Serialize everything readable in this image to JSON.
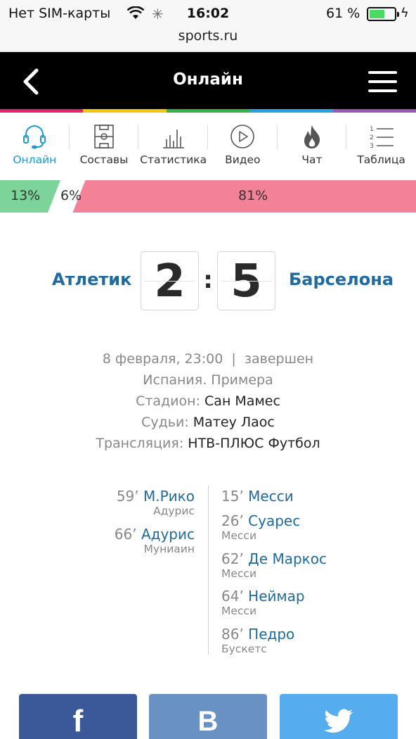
{
  "status_bar": {
    "carrier": "Нет SIM-карты",
    "time": "16:02",
    "battery_percent": "61 %",
    "battery_level": 0.61
  },
  "browser": {
    "url": "sports.ru"
  },
  "header": {
    "title": "Онлайн"
  },
  "color_strip": [
    "#e8246c",
    "#f6c512",
    "#34b34a",
    "#29a3e0",
    "#9b59b6"
  ],
  "tabs": [
    {
      "label": "Онлайн",
      "icon": "headset-icon",
      "active": true
    },
    {
      "label": "Составы",
      "icon": "field-icon",
      "active": false
    },
    {
      "label": "Статистика",
      "icon": "bar-chart-icon",
      "active": false
    },
    {
      "label": "Видео",
      "icon": "play-icon",
      "active": false
    },
    {
      "label": "Чат",
      "icon": "flame-icon",
      "active": false
    },
    {
      "label": "Таблица",
      "icon": "numbered-list-icon",
      "active": false
    }
  ],
  "prediction": {
    "home": "13%",
    "draw": "6%",
    "away": "81%",
    "home_value": 13,
    "draw_value": 6,
    "away_value": 81,
    "colors": {
      "home": "#7dd49b",
      "away": "#f38197"
    }
  },
  "match": {
    "home_team": "Атлетик",
    "away_team": "Барселона",
    "home_score": "2",
    "away_score": "5",
    "separator": ":",
    "datetime": "8 февраля, 23:00",
    "status": "завершен",
    "tournament": "Испания. Примера",
    "stadium_label": "Стадион:",
    "stadium": "Сан Мамес",
    "referee_label": "Судьи:",
    "referee": "Матеу Лаос",
    "broadcast_label": "Трансляция:",
    "broadcast": "НТВ-ПЛЮС Футбол"
  },
  "goals": {
    "home": [
      {
        "minute": "59’",
        "scorer": "М.Рико",
        "assist": "Адурис"
      },
      {
        "minute": "66’",
        "scorer": "Адурис",
        "assist": "Муниаин"
      }
    ],
    "away": [
      {
        "minute": "15’",
        "scorer": "Месси",
        "assist": ""
      },
      {
        "minute": "26’",
        "scorer": "Суарес",
        "assist": "Месси"
      },
      {
        "minute": "62’",
        "scorer": "Де Маркос",
        "assist": "Месси"
      },
      {
        "minute": "64’",
        "scorer": "Неймар",
        "assist": "Месси"
      },
      {
        "minute": "86’",
        "scorer": "Педро",
        "assist": "Бускетс"
      }
    ]
  },
  "share": [
    {
      "label": "f",
      "icon": "facebook-icon",
      "color": "#3b5998"
    },
    {
      "label": "B",
      "icon": "vkontakte-icon",
      "color": "#6a91c4"
    },
    {
      "label": "",
      "icon": "twitter-icon",
      "color": "#55acee"
    }
  ]
}
